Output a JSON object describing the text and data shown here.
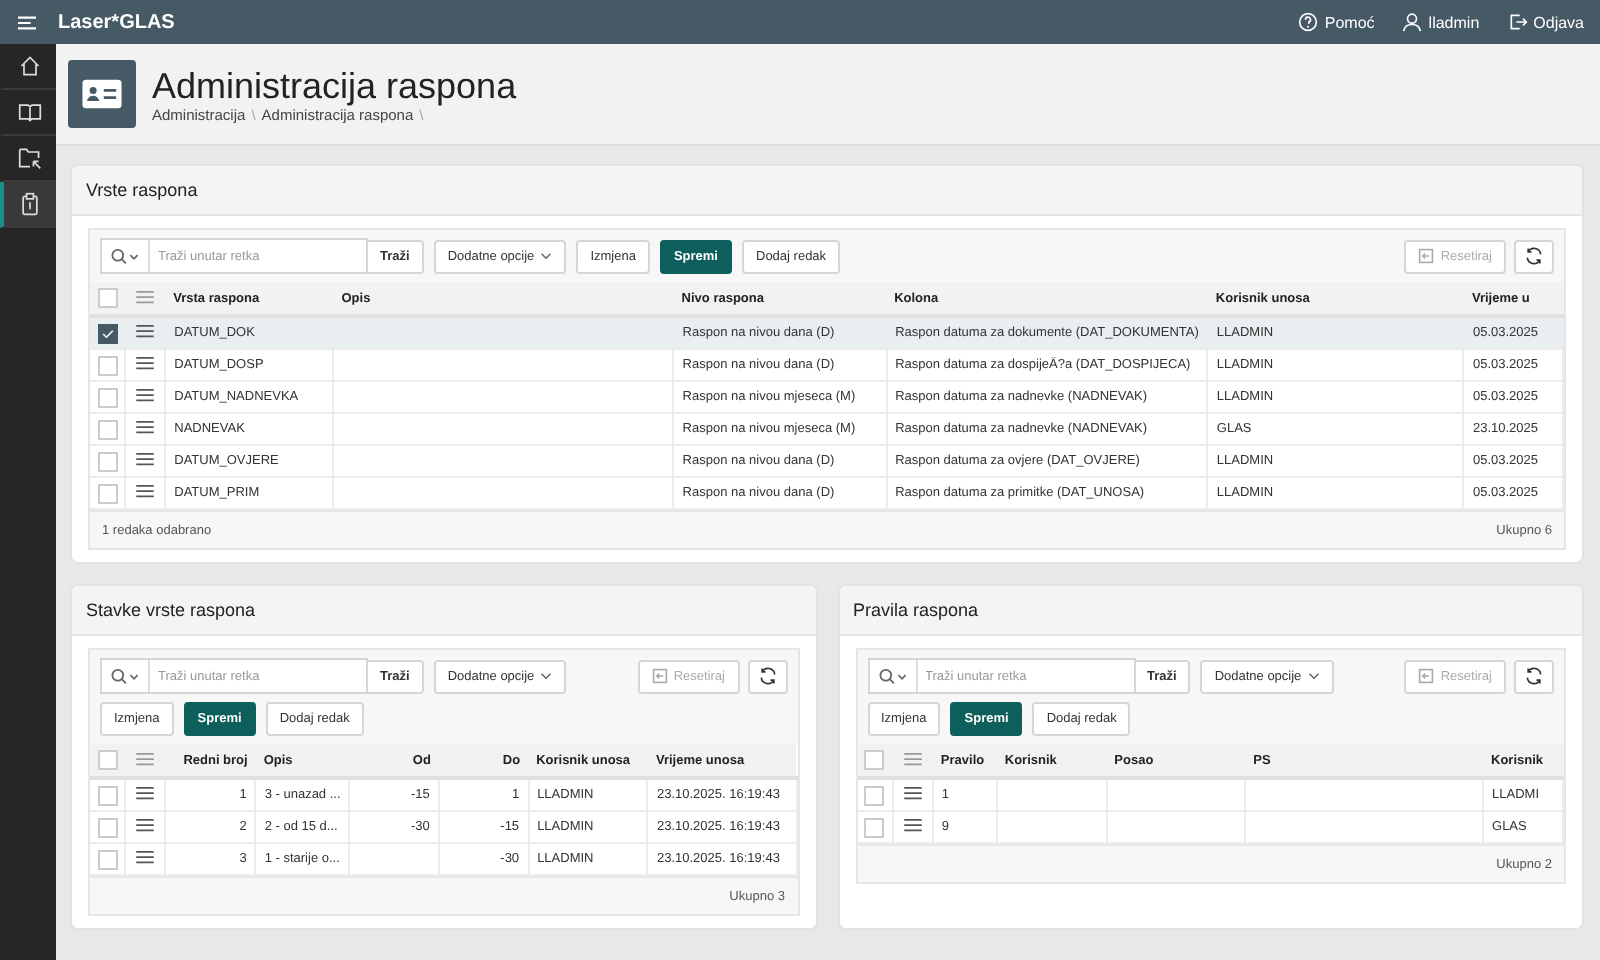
{
  "topbar": {
    "brand": "Laser*GLAS",
    "help": "Pomoć",
    "user": "lladmin",
    "logout": "Odjava"
  },
  "sidebar": {
    "items": [
      {
        "kind": "home",
        "selected": false
      },
      {
        "kind": "book",
        "selected": false
      },
      {
        "kind": "folder",
        "selected": false
      },
      {
        "kind": "clipboard",
        "selected": true
      }
    ]
  },
  "header": {
    "title": "Administracija raspona",
    "breadcrumb": [
      "Administracija",
      "Administracija raspona"
    ],
    "separator": "\\"
  },
  "panels": [
    {
      "title": "Vrste raspona",
      "toolbar": {
        "search_placeholder": "Traži unutar retka",
        "search_button": "Traži",
        "options_button": "Dodatne opcije",
        "edit_button": "Izmjena",
        "save_button": "Spremi",
        "add_row_button": "Dodaj redak",
        "reset_button": "Resetiraj",
        "reset_disabled": true
      },
      "all_selected": false,
      "columns": [
        "Vrsta raspona",
        "Opis",
        "Nivo raspona",
        "Kolona",
        "Korisnik unosa",
        "Vrijeme u"
      ],
      "rows": [
        {
          "selected": true,
          "cells": [
            "DATUM_DOK",
            "",
            "Raspon na nivou dana (D)",
            "Raspon datuma za dokumente (DAT_DOKUMENTA)",
            "LLADMIN",
            "05.03.2025"
          ]
        },
        {
          "selected": false,
          "cells": [
            "DATUM_DOSP",
            "",
            "Raspon na nivou dana (D)",
            "Raspon datuma za dospijeÄ?a (DAT_DOSPIJECA)",
            "LLADMIN",
            "05.03.2025"
          ]
        },
        {
          "selected": false,
          "cells": [
            "DATUM_NADNEVKA",
            "",
            "Raspon na nivou mjeseca (M)",
            "Raspon datuma za nadnevke (NADNEVAK)",
            "LLADMIN",
            "05.03.2025"
          ]
        },
        {
          "selected": false,
          "cells": [
            "NADNEVAK",
            "",
            "Raspon na nivou mjeseca (M)",
            "Raspon datuma za nadnevke (NADNEVAK)",
            "GLAS",
            "23.10.2025"
          ]
        },
        {
          "selected": false,
          "cells": [
            "DATUM_OVJERE",
            "",
            "Raspon na nivou dana (D)",
            "Raspon datuma za ovjere (DAT_OVJERE)",
            "LLADMIN",
            "05.03.2025"
          ]
        },
        {
          "selected": false,
          "cells": [
            "DATUM_PRIM",
            "",
            "Raspon na nivou dana (D)",
            "Raspon datuma za primitke (DAT_UNOSA)",
            "LLADMIN",
            "05.03.2025"
          ]
        }
      ],
      "selection_info": "1 redaka odabrano",
      "total": "Ukupno 6"
    },
    {
      "title": "Stavke vrste raspona",
      "toolbar": {
        "search_placeholder": "Traži unutar retka",
        "search_button": "Traži",
        "options_button": "Dodatne opcije",
        "edit_button": "Izmjena",
        "save_button": "Spremi",
        "add_row_button": "Dodaj redak",
        "reset_button": "Resetiraj",
        "reset_disabled": true
      },
      "all_selected": false,
      "columns": [
        "Redni broj",
        "Opis",
        "Od",
        "Do",
        "Korisnik unosa",
        "Vrijeme unosa"
      ],
      "rows": [
        {
          "selected": false,
          "cells": [
            "1",
            "3 - unazad ...",
            "-15",
            "1",
            "LLADMIN",
            "23.10.2025. 16:19:43"
          ]
        },
        {
          "selected": false,
          "cells": [
            "2",
            "2 - od 15 d...",
            "-30",
            "-15",
            "LLADMIN",
            "23.10.2025. 16:19:43"
          ]
        },
        {
          "selected": false,
          "cells": [
            "3",
            "1 - starije o...",
            "",
            "-30",
            "LLADMIN",
            "23.10.2025. 16:19:43"
          ]
        }
      ],
      "total": "Ukupno 3"
    },
    {
      "title": "Pravila raspona",
      "toolbar": {
        "search_placeholder": "Traži unutar retka",
        "search_button": "Traži",
        "options_button": "Dodatne opcije",
        "edit_button": "Izmjena",
        "save_button": "Spremi",
        "add_row_button": "Dodaj redak",
        "reset_button": "Resetiraj",
        "reset_disabled": true
      },
      "all_selected": false,
      "columns": [
        "Pravilo",
        "Korisnik",
        "Posao",
        "PS",
        "Korisnik"
      ],
      "rows": [
        {
          "selected": false,
          "cells": [
            "1",
            "",
            "",
            "",
            "LLADMI"
          ]
        },
        {
          "selected": false,
          "cells": [
            "9",
            "",
            "",
            "",
            "GLAS"
          ]
        }
      ],
      "total": "Ukupno 2"
    }
  ]
}
